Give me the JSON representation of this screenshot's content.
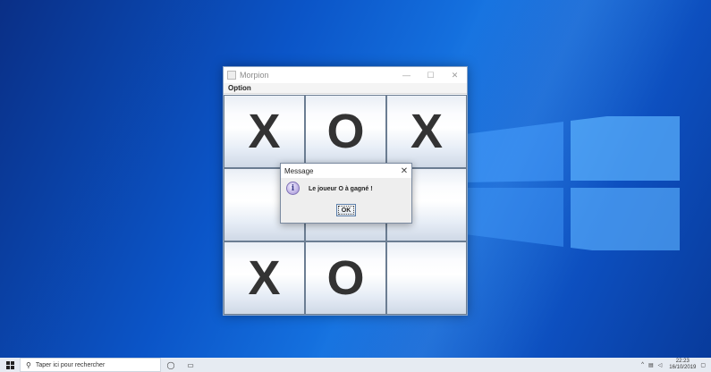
{
  "window": {
    "title": "Morpion",
    "controls": {
      "minimize": "—",
      "maximize": "☐",
      "close": "✕"
    }
  },
  "menu": {
    "option": "Option"
  },
  "board": [
    [
      "X",
      "O",
      "X"
    ],
    [
      "",
      "",
      ""
    ],
    [
      "X",
      "O",
      ""
    ]
  ],
  "dialog": {
    "title": "Message",
    "close": "✕",
    "icon": "i",
    "message": "Le joueur O à gagné !",
    "ok": "OK"
  },
  "taskbar": {
    "search_placeholder": "Taper ici pour rechercher",
    "time": "22:23",
    "date": "16/10/2019"
  }
}
